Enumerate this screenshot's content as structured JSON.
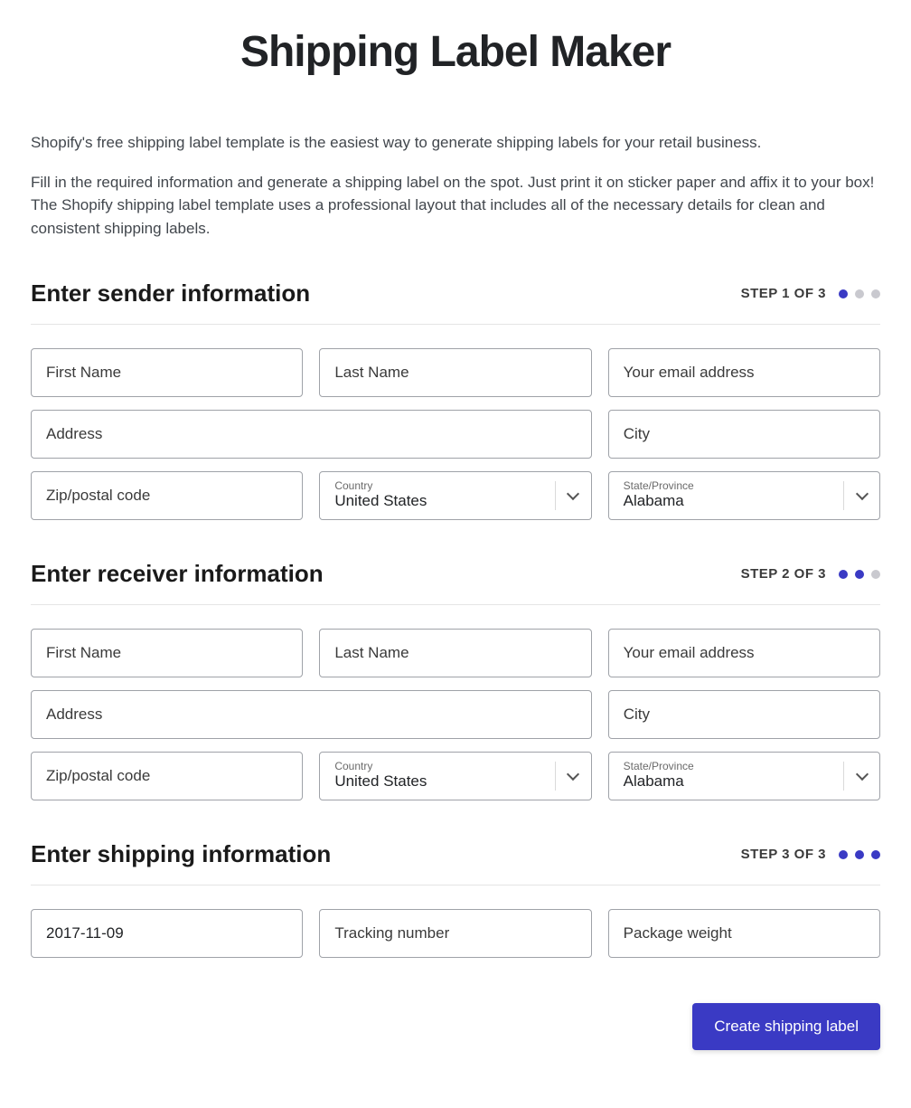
{
  "title": "Shipping Label Maker",
  "intro1": "Shopify's free shipping label template is the easiest way to generate shipping labels for your retail business.",
  "intro2": "Fill in the required information and generate a shipping label on the spot. Just print it on sticker paper and affix it to your box! The Shopify shipping label template uses a professional layout that includes all of the necessary details for clean and consistent shipping labels.",
  "sender": {
    "heading": "Enter sender information",
    "step": "STEP 1 OF 3",
    "first_name_placeholder": "First Name",
    "last_name_placeholder": "Last Name",
    "email_placeholder": "Your email address",
    "address_placeholder": "Address",
    "city_placeholder": "City",
    "zip_placeholder": "Zip/postal code",
    "country_label": "Country",
    "country_value": "United States",
    "state_label": "State/Province",
    "state_value": "Alabama"
  },
  "receiver": {
    "heading": "Enter receiver information",
    "step": "STEP 2 OF 3",
    "first_name_placeholder": "First Name",
    "last_name_placeholder": "Last Name",
    "email_placeholder": "Your email address",
    "address_placeholder": "Address",
    "city_placeholder": "City",
    "zip_placeholder": "Zip/postal code",
    "country_label": "Country",
    "country_value": "United States",
    "state_label": "State/Province",
    "state_value": "Alabama"
  },
  "shipping": {
    "heading": "Enter shipping information",
    "step": "STEP 3 OF 3",
    "date_value": "2017-11-09",
    "tracking_placeholder": "Tracking number",
    "weight_placeholder": "Package weight"
  },
  "button": "Create shipping label"
}
